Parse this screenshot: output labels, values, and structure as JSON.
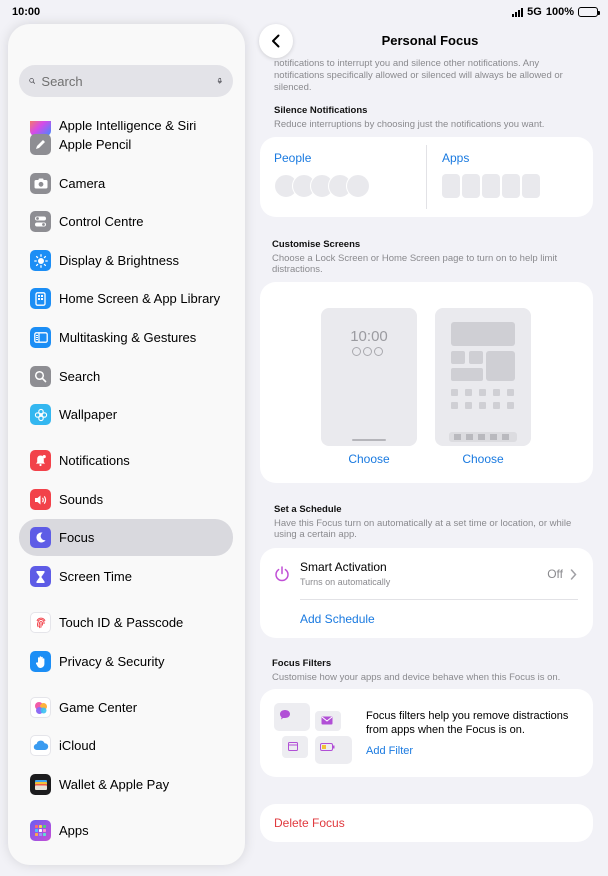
{
  "status": {
    "time": "10:00",
    "network": "5G",
    "battery": "100%"
  },
  "sidebar": {
    "search_placeholder": "Search",
    "clipped_item": "Apple Intelligence & Siri",
    "items": [
      {
        "label": "Apple Pencil",
        "icon": "pencil-icon",
        "color": "#8e8e93"
      },
      {
        "label": "Camera",
        "icon": "camera-icon",
        "color": "#8e8e93"
      },
      {
        "label": "Control Centre",
        "icon": "toggles-icon",
        "color": "#8e8e93"
      },
      {
        "label": "Display & Brightness",
        "icon": "sun-icon",
        "color": "#1c8ef5"
      },
      {
        "label": "Home Screen & App Library",
        "icon": "home-screen-icon",
        "color": "#1c8ef5"
      },
      {
        "label": "Multitasking & Gestures",
        "icon": "multitasking-icon",
        "color": "#1c8ef5"
      },
      {
        "label": "Search",
        "icon": "search-icon",
        "color": "#8e8e93"
      },
      {
        "label": "Wallpaper",
        "icon": "flower-icon",
        "color": "#34b7f0"
      },
      {
        "label": "Notifications",
        "icon": "bell-icon",
        "color": "#f2424a"
      },
      {
        "label": "Sounds",
        "icon": "speaker-icon",
        "color": "#f2424a"
      },
      {
        "label": "Focus",
        "icon": "moon-icon",
        "color": "#5e5ce6"
      },
      {
        "label": "Screen Time",
        "icon": "hourglass-icon",
        "color": "#5e5ce6"
      },
      {
        "label": "Touch ID & Passcode",
        "icon": "fingerprint-icon",
        "color": "#ffffff"
      },
      {
        "label": "Privacy & Security",
        "icon": "hand-icon",
        "color": "#1c8ef5"
      },
      {
        "label": "Game Center",
        "icon": "game-center-icon",
        "color": "#ffffff"
      },
      {
        "label": "iCloud",
        "icon": "cloud-icon",
        "color": "#ffffff"
      },
      {
        "label": "Wallet & Apple Pay",
        "icon": "wallet-icon",
        "color": "#1c1c1e"
      },
      {
        "label": "Apps",
        "icon": "apps-grid-icon",
        "color": "#6b5cf0"
      }
    ]
  },
  "main": {
    "title": "Personal Focus",
    "top_text": "notifications to interrupt you and silence other notifications. Any notifications specifically allowed or silenced will always be allowed or silenced.",
    "silence": {
      "title": "Silence Notifications",
      "desc": "Reduce interruptions by choosing just the notifications you want.",
      "people_label": "People",
      "apps_label": "Apps"
    },
    "customise": {
      "title": "Customise Screens",
      "desc": "Choose a Lock Screen or Home Screen page to turn on to help limit distractions.",
      "lock_time": "10:00",
      "choose_1": "Choose",
      "choose_2": "Choose"
    },
    "schedule": {
      "title": "Set a Schedule",
      "desc": "Have this Focus turn on automatically at a set time or location, or while using a certain app.",
      "smart_title": "Smart Activation",
      "smart_sub": "Turns on automatically",
      "smart_value": "Off",
      "add_schedule": "Add Schedule"
    },
    "filters": {
      "title": "Focus Filters",
      "desc": "Customise how your apps and device behave when this Focus is on.",
      "body": "Focus filters help you remove distractions from apps when the Focus is on.",
      "add_filter": "Add Filter"
    },
    "delete_label": "Delete Focus"
  },
  "colors": {
    "accent": "#1a7ae0",
    "danger": "#e0393e",
    "focus_purple": "#5e5ce6",
    "power_purple": "#c04fd6"
  }
}
